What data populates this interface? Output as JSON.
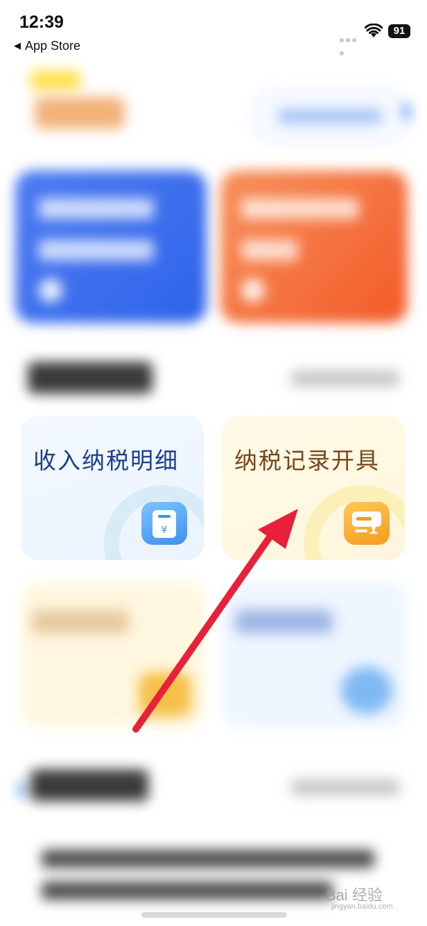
{
  "status_bar": {
    "time": "12:39",
    "back_label": "App Store",
    "battery": "91",
    "icons": [
      "signal-dots-icon",
      "wifi-icon",
      "battery-icon"
    ]
  },
  "services": [
    {
      "label": "收入纳税明细",
      "icon": "wallet-yuan-icon",
      "accent": "#1b3f8f"
    },
    {
      "label": "纳税记录开具",
      "icon": "certificate-stamp-icon",
      "accent": "#7a4318"
    }
  ],
  "annotation": {
    "arrow_color": "#e8203a"
  },
  "watermark": {
    "text": "Bai 经验",
    "sub": "jingyan.baidu.com"
  }
}
